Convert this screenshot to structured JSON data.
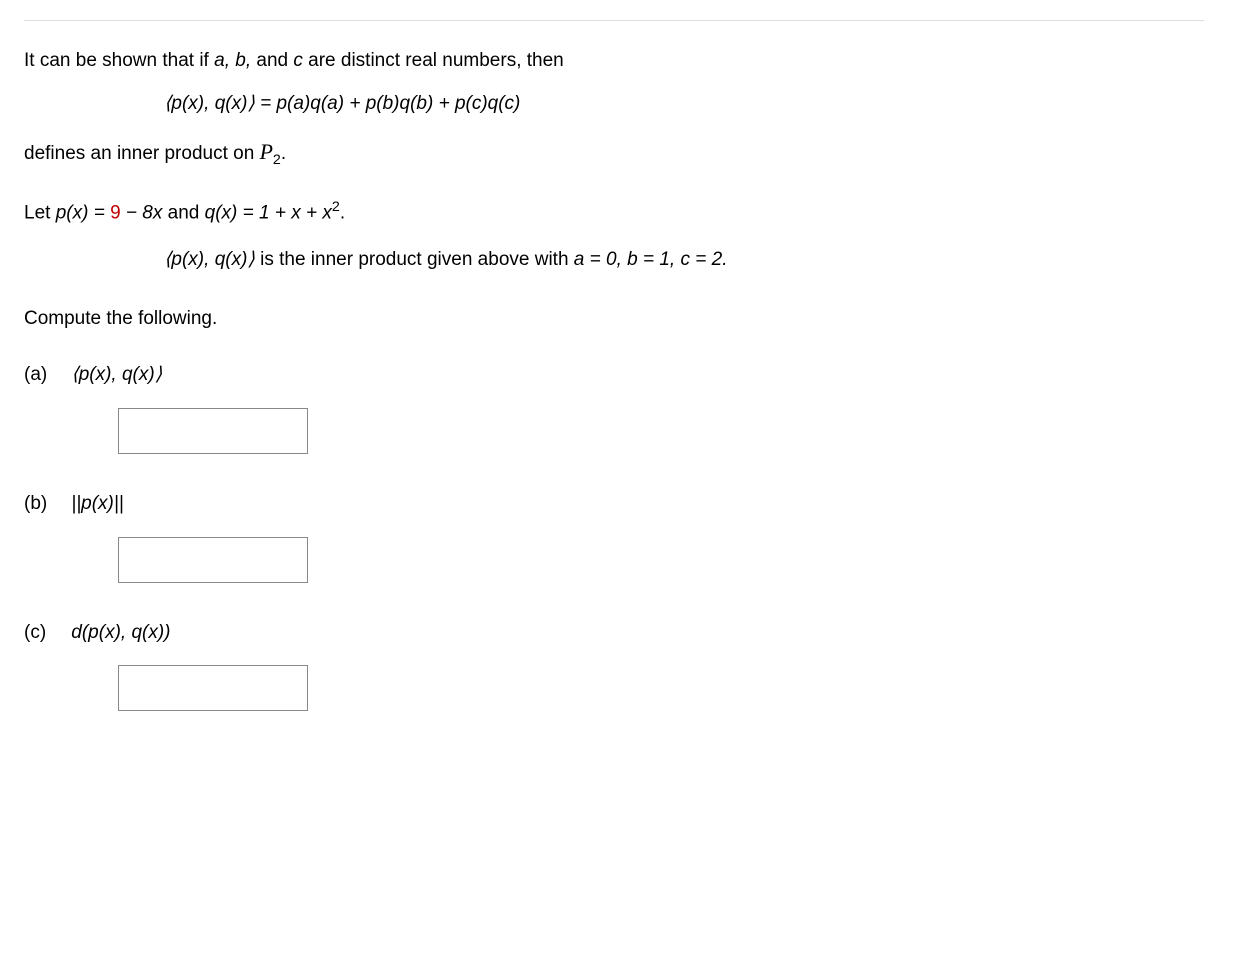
{
  "intro": {
    "line1_pre": "It can be shown that if ",
    "line1_vars": "a, b,",
    "line1_mid": " and ",
    "line1_var_c": "c",
    "line1_post": " are distinct real numbers, then",
    "equation": "⟨p(x), q(x)⟩ = p(a)q(a) + p(b)q(b) + p(c)q(c)",
    "line2_pre": "defines an inner product on ",
    "line2_space": "P",
    "line2_sub": "2",
    "line2_end": "."
  },
  "setup": {
    "let_pre": "Let ",
    "let_p": "p(x) = ",
    "p_const": "9",
    "p_rest": " − 8x",
    "let_and": " and ",
    "let_q": "q(x) = 1 + x + x",
    "q_exp": "2",
    "let_end": ".",
    "inner_text_pre": "⟨p(x), q(x)⟩",
    "inner_text_post": " is the inner product given above with ",
    "assign": "a = 0, b = 1, c = 2."
  },
  "prompt": "Compute the following.",
  "parts": {
    "a": {
      "label": "(a)",
      "expr": "⟨p(x), q(x)⟩",
      "value": ""
    },
    "b": {
      "label": "(b)",
      "expr": "||p(x)||",
      "value": ""
    },
    "c": {
      "label": "(c)",
      "expr": "d(p(x), q(x))",
      "value": ""
    }
  }
}
